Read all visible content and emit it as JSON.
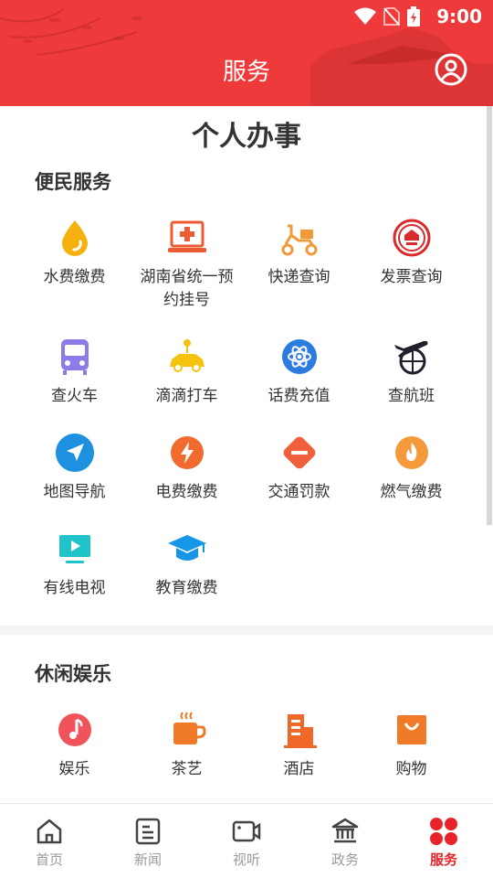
{
  "status": {
    "time": "9:00"
  },
  "header": {
    "title": "服务"
  },
  "page": {
    "title": "个人办事"
  },
  "sections": [
    {
      "title": "便民服务",
      "items": [
        {
          "label": "水费缴费",
          "icon": "water-drop-icon"
        },
        {
          "label": "湖南省统一预约挂号",
          "icon": "hospital-laptop-icon"
        },
        {
          "label": "快递查询",
          "icon": "delivery-scooter-icon"
        },
        {
          "label": "发票查询",
          "icon": "emblem-icon"
        },
        {
          "label": "查火车",
          "icon": "train-icon"
        },
        {
          "label": "滴滴打车",
          "icon": "taxi-icon"
        },
        {
          "label": "话费充值",
          "icon": "atom-icon"
        },
        {
          "label": "查航班",
          "icon": "plane-globe-icon"
        },
        {
          "label": "地图导航",
          "icon": "navigation-arrow-icon"
        },
        {
          "label": "电费缴费",
          "icon": "lightning-icon"
        },
        {
          "label": "交通罚款",
          "icon": "no-entry-icon"
        },
        {
          "label": "燃气缴费",
          "icon": "flame-icon"
        },
        {
          "label": "有线电视",
          "icon": "tv-icon"
        },
        {
          "label": "教育缴费",
          "icon": "graduation-cap-icon"
        }
      ]
    },
    {
      "title": "休闲娱乐",
      "items": [
        {
          "label": "娱乐",
          "icon": "music-note-icon"
        },
        {
          "label": "茶艺",
          "icon": "tea-cup-icon"
        },
        {
          "label": "酒店",
          "icon": "hotel-building-icon"
        },
        {
          "label": "购物",
          "icon": "shopping-bag-icon"
        }
      ]
    }
  ],
  "nav": [
    {
      "label": "首页",
      "icon": "home-icon",
      "active": false
    },
    {
      "label": "新闻",
      "icon": "news-icon",
      "active": false
    },
    {
      "label": "视听",
      "icon": "video-camera-icon",
      "active": false
    },
    {
      "label": "政务",
      "icon": "government-building-icon",
      "active": false
    },
    {
      "label": "服务",
      "icon": "grid-dots-icon",
      "active": true
    }
  ],
  "colors": {
    "brand": "#ee3a3a",
    "nav_active": "#e8242a",
    "nav_inactive": "#9a9a9a"
  }
}
